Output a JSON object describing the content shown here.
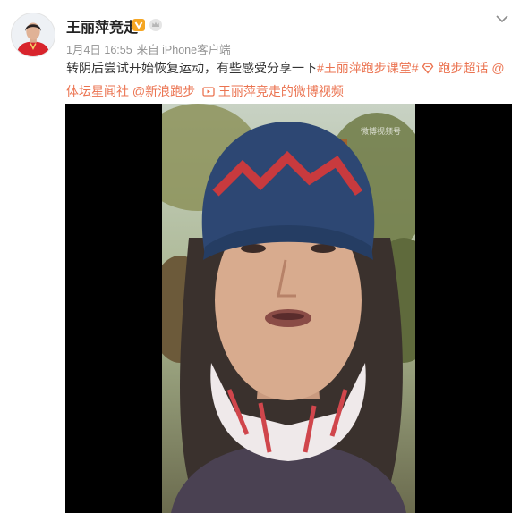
{
  "user": {
    "name": "王丽萍竞走",
    "date": "1月4日 16:55",
    "source": "来自 iPhone客户端"
  },
  "post": {
    "text_lead": "转阴后尝试开始恢复运动，有些感受分享一下",
    "hashtag": "#王丽萍跑步课堂#",
    "super_topic": "跑步超话",
    "mention_1": "@体坛星闻社",
    "mention_2": "@新浪跑步",
    "video_link": "王丽萍竞走的微博视频"
  },
  "video": {
    "watermark": "微博视频号"
  },
  "colors": {
    "link": "#eb7350",
    "verified": "#f5a623"
  }
}
